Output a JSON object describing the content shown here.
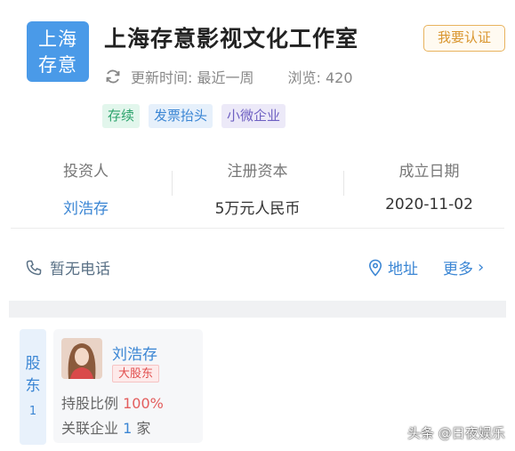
{
  "company": {
    "logo_line1": "上海",
    "logo_line2": "存意",
    "name": "上海存意影视文化工作室",
    "claim_button": "我要认证",
    "updated": "更新时间: 最近一周",
    "views": "浏览: 420",
    "tags": [
      "存续",
      "发票抬头",
      "小微企业"
    ]
  },
  "stats": [
    {
      "key": "投资人",
      "value": "刘浩存"
    },
    {
      "key": "注册资本",
      "value": "5万元人民币"
    },
    {
      "key": "成立日期",
      "value": "2020-11-02"
    }
  ],
  "contact": {
    "phone": "暂无电话",
    "address": "地址",
    "more": "更多"
  },
  "shareholders": {
    "side_label_1": "股",
    "side_label_2": "东",
    "count": "1",
    "name": "刘浩存",
    "badge": "大股东",
    "ratio_label": "持股比例",
    "ratio_value": "100%",
    "related_label": "关联企业",
    "related_count": "1",
    "related_unit": "家"
  },
  "watermark": "头条 @日夜娱乐",
  "colors": {
    "accent": "#3b86d4",
    "logo_bg": "#4a9ae8",
    "claim": "#d9952e",
    "ratio": "#e35d5d"
  },
  "icons": [
    "refresh-icon",
    "phone-icon",
    "location-pin-icon",
    "chevron-right-icon"
  ]
}
